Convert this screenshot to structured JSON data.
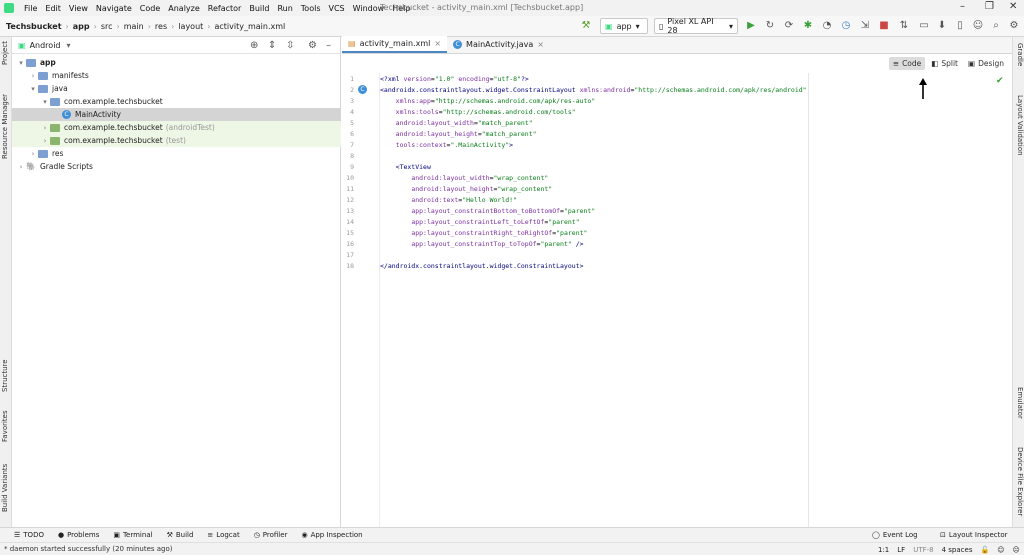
{
  "window": {
    "title": "Techsbucket - activity_main.xml [Techsbucket.app]"
  },
  "menu": [
    "File",
    "Edit",
    "View",
    "Navigate",
    "Code",
    "Analyze",
    "Refactor",
    "Build",
    "Run",
    "Tools",
    "VCS",
    "Window",
    "Help"
  ],
  "breadcrumbs": [
    "Techsbucket",
    "app",
    "src",
    "main",
    "res",
    "layout",
    "activity_main.xml"
  ],
  "run_config": "app",
  "device": "Pixel XL API 28",
  "project_panel": {
    "view": "Android",
    "tree": [
      {
        "label": "app",
        "indent": 0,
        "bold": true
      },
      {
        "label": "manifests",
        "indent": 1
      },
      {
        "label": "java",
        "indent": 1
      },
      {
        "label": "com.example.techsbucket",
        "indent": 2
      },
      {
        "label": "MainActivity",
        "indent": 3,
        "selected": true
      },
      {
        "label": "com.example.techsbucket",
        "suffix": "(androidTest)",
        "indent": 2
      },
      {
        "label": "com.example.techsbucket",
        "suffix": "(test)",
        "indent": 2
      },
      {
        "label": "res",
        "indent": 1
      },
      {
        "label": "Gradle Scripts",
        "indent": 0
      }
    ]
  },
  "editor": {
    "tabs": [
      "activity_main.xml",
      "MainActivity.java"
    ],
    "view_modes": [
      "Code",
      "Split",
      "Design"
    ],
    "line_numbers": [
      "1",
      "2",
      "3",
      "4",
      "5",
      "6",
      "7",
      "8",
      "9",
      "10",
      "11",
      "12",
      "13",
      "14",
      "15",
      "16",
      "17",
      "18"
    ]
  },
  "side_tabs_left": [
    "Project",
    "Resource Manager",
    "Structure",
    "Favorites",
    "Build Variants"
  ],
  "side_tabs_right": [
    "Gradle",
    "Layout Validation",
    "Emulator",
    "Device File Explorer"
  ],
  "bottom_tools": [
    "TODO",
    "Problems",
    "Terminal",
    "Build",
    "Logcat",
    "Profiler",
    "App Inspection"
  ],
  "bottom_right_tools": [
    "Event Log",
    "Layout Inspector"
  ],
  "status": {
    "message": "* daemon started successfully (20 minutes ago)",
    "position": "1:1",
    "line_sep": "LF",
    "encoding": "UTF-8",
    "indent": "4 spaces"
  }
}
